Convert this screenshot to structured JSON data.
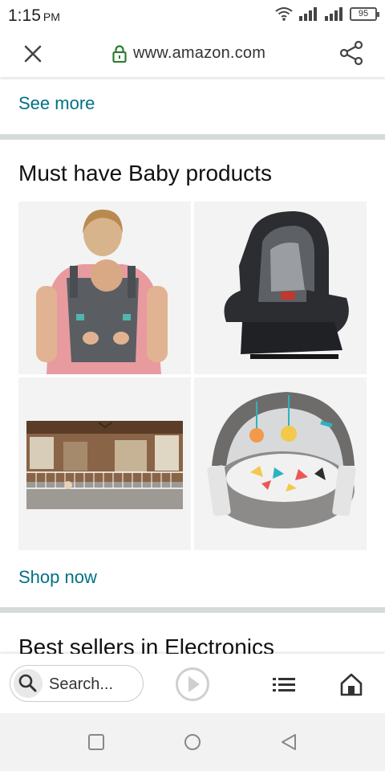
{
  "status_bar": {
    "time": "1:15",
    "ampm": "PM",
    "battery": "95"
  },
  "url_bar": {
    "url": "www.amazon.com"
  },
  "content": {
    "see_more": "See more",
    "section_title": "Must have Baby products",
    "shop_now": "Shop now",
    "next_section_title": "Best sellers in Electronics",
    "products": [
      {
        "name": "baby-carrier"
      },
      {
        "name": "convertible-car-seat"
      },
      {
        "name": "baby-gate"
      },
      {
        "name": "play-dome"
      }
    ]
  },
  "bottom_bar": {
    "search_placeholder": "Search..."
  },
  "colors": {
    "link": "#007185",
    "divider": "#d5dbdb",
    "lock_green": "#2e7d32"
  }
}
